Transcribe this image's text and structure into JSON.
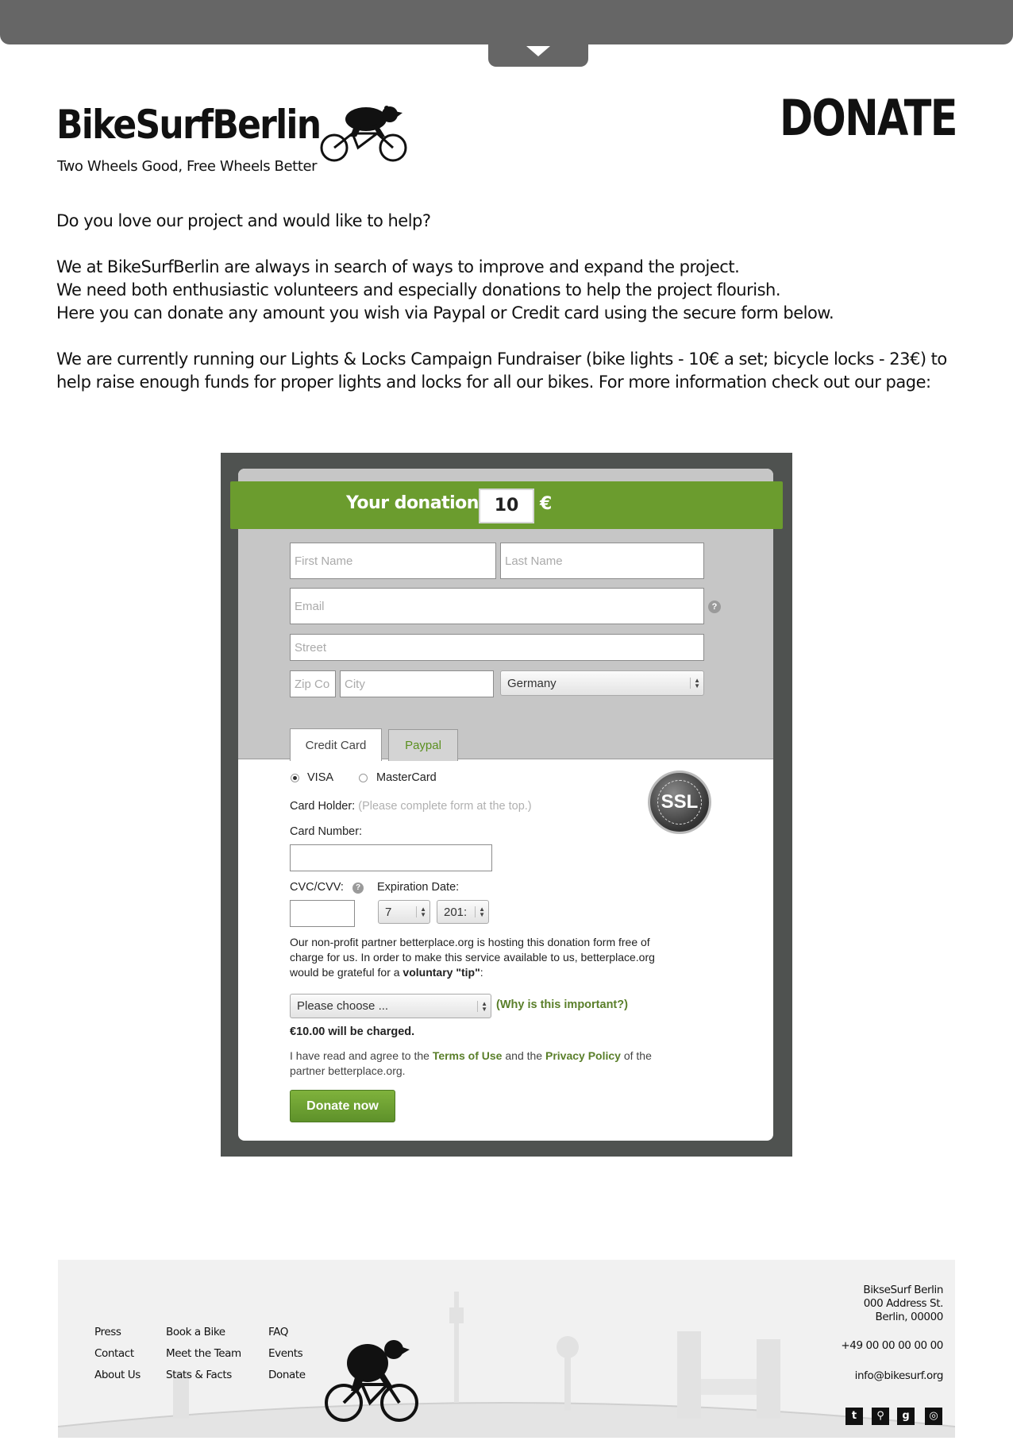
{
  "header": {
    "logo_text": "BikeSurfBerlin",
    "tagline": "Two Wheels Good, Free Wheels Better",
    "page_heading": "DONATE"
  },
  "intro": {
    "p1": "Do you love our project and would like to help?",
    "p2_l1": "We at BikeSurfBerlin are always in search of ways to improve and expand the project.",
    "p2_l2": "We need both enthusiastic volunteers and especially donations to help the project flourish.",
    "p2_l3": "Here you can donate any amount you wish via Paypal or Credit card using the secure form below.",
    "p3": "We are currently running our Lights & Locks Campaign Fundraiser (bike lights - 10€ a set; bicycle locks - 23€) to help raise enough funds for proper lights and locks for all our bikes.  For more information check out our page:"
  },
  "donation": {
    "banner_label": "Your donation",
    "amount": "10",
    "currency": "€",
    "first_name_placeholder": "First Name",
    "last_name_placeholder": "Last Name",
    "email_placeholder": "Email",
    "street_placeholder": "Street",
    "zip_placeholder": "Zip Co",
    "city_placeholder": "City",
    "country": "Germany",
    "tabs": [
      "Credit Card",
      "Paypal"
    ],
    "card_types": [
      "VISA",
      "MasterCard"
    ],
    "card_holder_label": "Card Holder:",
    "card_holder_hint": "(Please complete form at the top.)",
    "card_number_label": "Card Number:",
    "cvc_label": "CVC/CVV:",
    "expiration_label": "Expiration Date:",
    "exp_month": "7",
    "exp_year": "201:",
    "ssl_label": "SSL",
    "tip_text_l1": "Our non-profit partner betterplace.org is hosting this donation form free of",
    "tip_text_l2": "charge for us. In order to make this service available to us, betterplace.org",
    "tip_text_l3_pre": "would be grateful for a ",
    "tip_text_l3_bold": "voluntary \"tip\"",
    "tip_text_l3_post": ":",
    "tip_select": "Please choose ...",
    "why_link": "(Why is this important?)",
    "charge_text": "€10.00 will be charged.",
    "terms_pre": "I have read and agree to the ",
    "terms_link": "Terms of Use",
    "terms_mid": " and the ",
    "privacy_link": "Privacy Policy",
    "terms_post": " of the",
    "terms_l2": "partner betterplace.org.",
    "donate_button": "Donate now"
  },
  "footer": {
    "col1": [
      "Press",
      "Contact",
      "About Us"
    ],
    "col2": [
      "Book a Bike",
      "Meet the Team",
      "Stats & Facts"
    ],
    "col3": [
      "FAQ",
      "Events",
      "Donate"
    ],
    "address_l1": "BikseSurf Berlin",
    "address_l2": "000 Address St.",
    "address_l3": "Berlin, 00000",
    "phone": "+49 00 00 00 00 00",
    "email": "info@bikesurf.org",
    "social_icons": [
      "twitter-icon",
      "link-icon",
      "google-plus-icon",
      "instagram-icon"
    ]
  }
}
